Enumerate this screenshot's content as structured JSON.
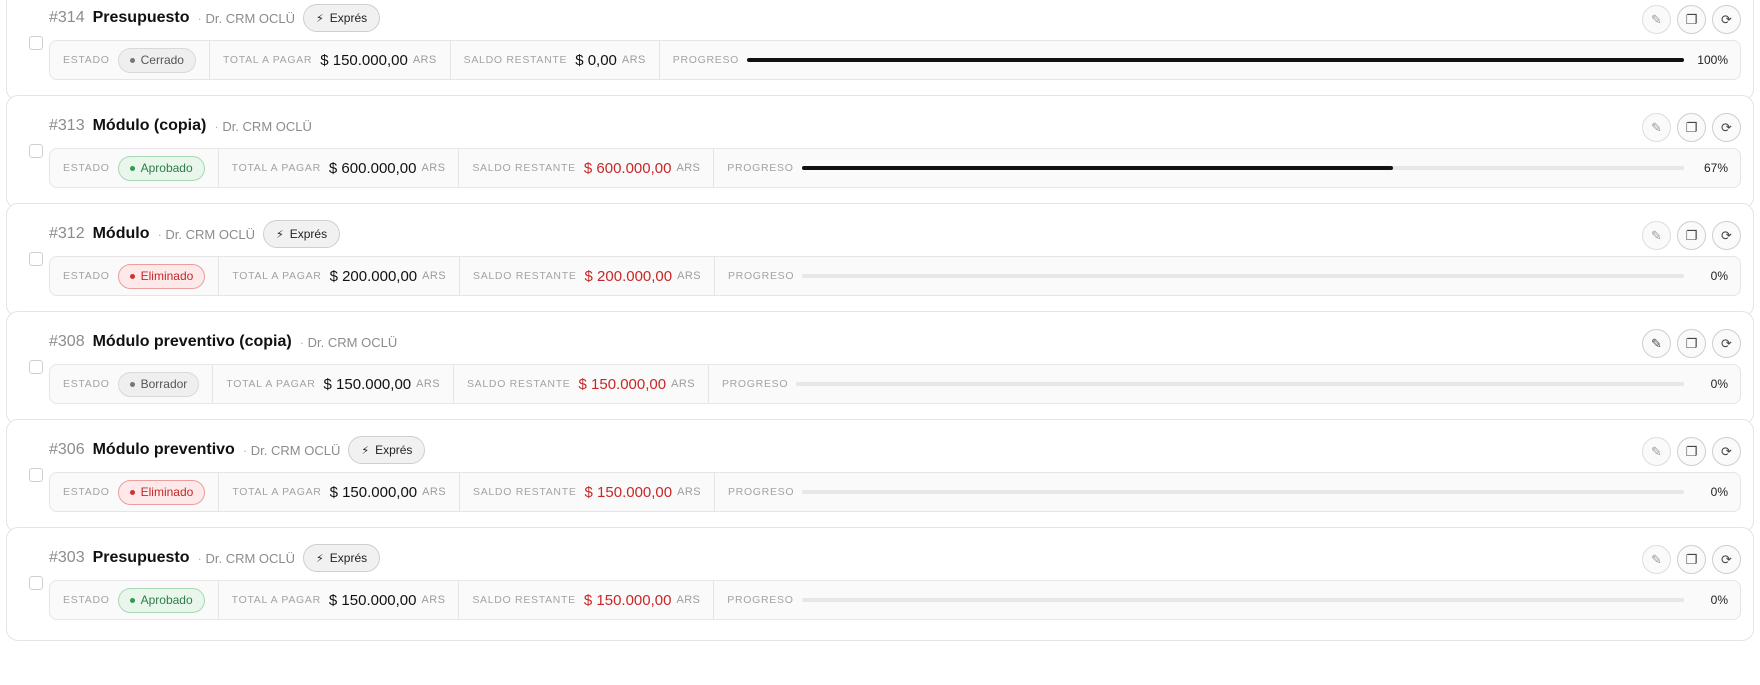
{
  "labels": {
    "estado": "Estado",
    "total": "Total a pagar",
    "saldo": "Saldo restante",
    "progreso": "Progreso",
    "expres": "Exprés",
    "currency": "ARS"
  },
  "icons": {
    "edit": "pencil-icon",
    "copy": "copy-icon",
    "refresh": "refresh-icon",
    "express": "bolt-icon"
  },
  "colors": {
    "gray": "#777777",
    "green": "#2e9d50",
    "red": "#d32f2f",
    "progress": "#111111"
  },
  "items": [
    {
      "number": "#314",
      "name": "Presupuesto",
      "doctor": "Dr. CRM OCLÜ",
      "express": true,
      "status": "Cerrado",
      "status_tone": "grey",
      "total": "$ 150.000,00",
      "saldo": "$ 0,00",
      "saldo_red": false,
      "progress": 1.0,
      "progress_text": "100%",
      "edit_enabled": false
    },
    {
      "number": "#313",
      "name": "Módulo (copia)",
      "doctor": "Dr. CRM OCLÜ",
      "express": false,
      "status": "Aprobado",
      "status_tone": "green",
      "total": "$ 600.000,00",
      "saldo": "$ 600.000,00",
      "saldo_red": true,
      "progress": 0.67,
      "progress_text": "67%",
      "edit_enabled": false
    },
    {
      "number": "#312",
      "name": "Módulo",
      "doctor": "Dr. CRM OCLÜ",
      "express": true,
      "status": "Eliminado",
      "status_tone": "red",
      "total": "$ 200.000,00",
      "saldo": "$ 200.000,00",
      "saldo_red": true,
      "progress": 0,
      "progress_text": "0%",
      "edit_enabled": false
    },
    {
      "number": "#308",
      "name": "Módulo preventivo (copia)",
      "doctor": "Dr. CRM OCLÜ",
      "express": false,
      "status": "Borrador",
      "status_tone": "grey",
      "total": "$ 150.000,00",
      "saldo": "$ 150.000,00",
      "saldo_red": true,
      "progress": 0,
      "progress_text": "0%",
      "edit_enabled": true
    },
    {
      "number": "#306",
      "name": "Módulo preventivo",
      "doctor": "Dr. CRM OCLÜ",
      "express": true,
      "status": "Eliminado",
      "status_tone": "red",
      "total": "$ 150.000,00",
      "saldo": "$ 150.000,00",
      "saldo_red": true,
      "progress": 0,
      "progress_text": "0%",
      "edit_enabled": false
    },
    {
      "number": "#303",
      "name": "Presupuesto",
      "doctor": "Dr. CRM OCLÜ",
      "express": true,
      "status": "Aprobado",
      "status_tone": "green",
      "total": "$ 150.000,00",
      "saldo": "$ 150.000,00",
      "saldo_red": true,
      "progress": 0,
      "progress_text": "0%",
      "edit_enabled": false
    }
  ]
}
